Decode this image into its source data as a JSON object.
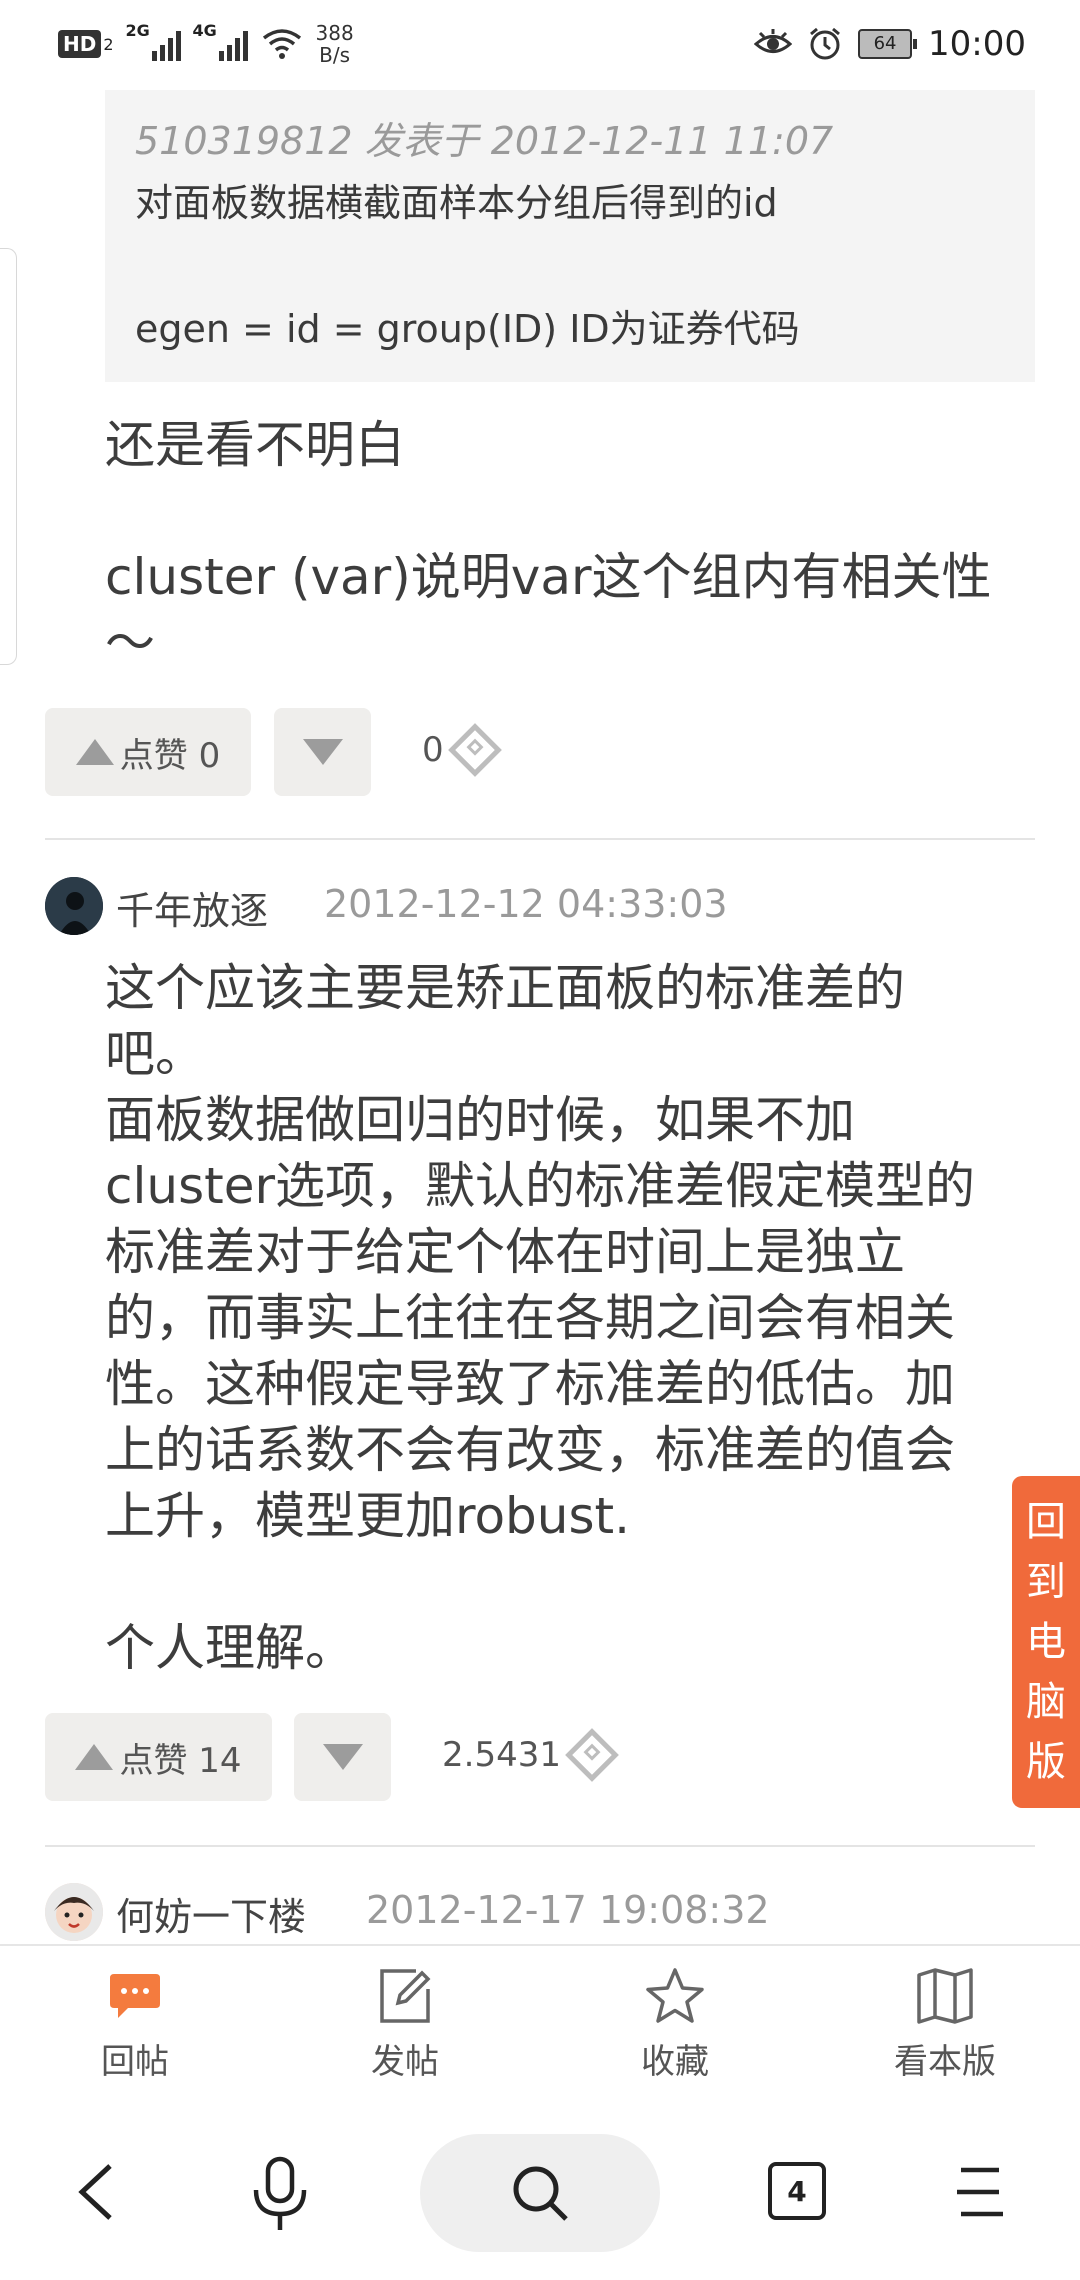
{
  "status_bar": {
    "hd": "HD",
    "hd_sub": "2",
    "sig1_label": "2G",
    "sig2_label": "4G",
    "speed_value": "388",
    "speed_unit": "B/s",
    "battery": "64",
    "time": "10:00"
  },
  "quote": {
    "meta": "510319812 发表于 2012-12-11 11:07",
    "line1": "对面板数据横截面样本分组后得到的id",
    "line2": "egen = id = group(ID) ID为证券代码"
  },
  "post1": {
    "text": "还是看不明白\n\ncluster (var)说明var这个组内有相关性\n～",
    "like_label": "点赞 0",
    "score": "0"
  },
  "post2": {
    "username": "千年放逐",
    "date": "2012-12-12 04:33:03",
    "text": "这个应该主要是矫正面板的标准差的\n吧。\n面板数据做回归的时候，如果不加\ncluster选项，默认的标准差假定模型的\n标准差对于给定个体在时间上是独立\n的，而事实上往往在各期之间会有相关\n性。这种假定导致了标准差的低估。加\n上的话系数不会有改变，标准差的值会\n上升，模型更加robust.\n\n个人理解。",
    "like_label": "点赞 14",
    "score": "2.5431"
  },
  "post3": {
    "username": "何妨一下楼",
    "date": "2012-12-17 19:08:32"
  },
  "side_button": [
    "回",
    "到",
    "电",
    "脑",
    "版"
  ],
  "toolbar": {
    "reply": "回帖",
    "post": "发帖",
    "favorite": "收藏",
    "board": "看本版"
  },
  "browser_nav": {
    "tabs_count": "4"
  }
}
